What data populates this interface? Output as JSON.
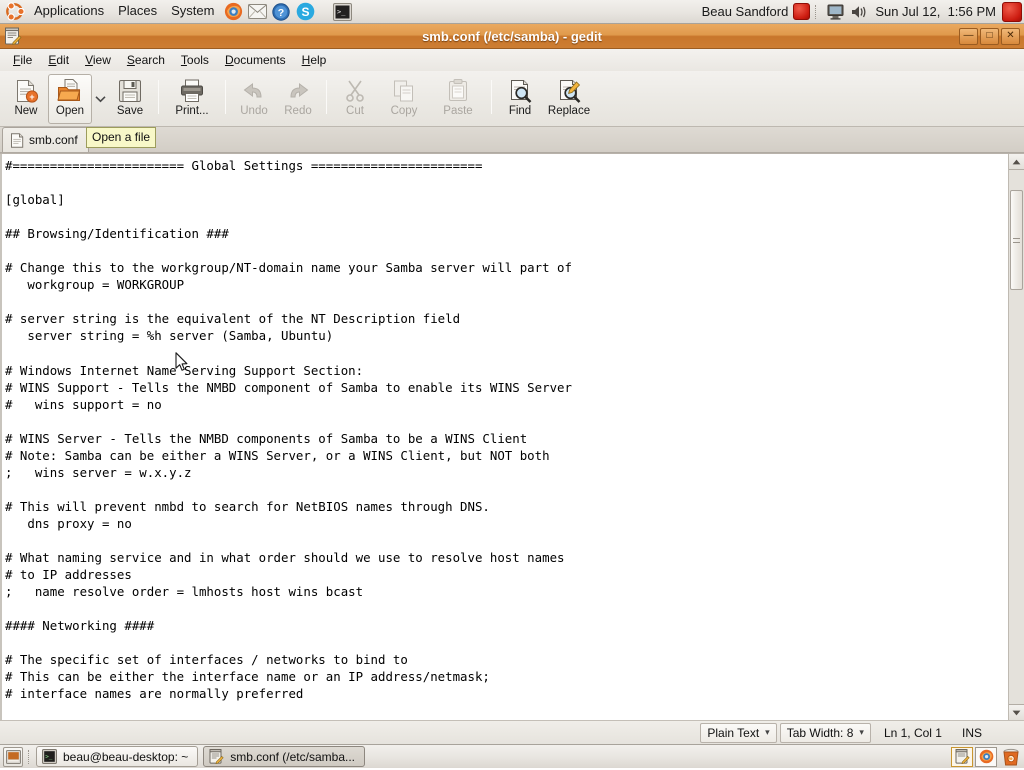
{
  "top_panel": {
    "logo": "ubuntu-logo",
    "menus": [
      "Applications",
      "Places",
      "System"
    ],
    "launchers": [
      "firefox-icon",
      "evolution-mail-icon",
      "help-icon",
      "skype-icon",
      "terminal-icon"
    ],
    "user_name": "Beau Sandford",
    "tray": [
      "display-icon",
      "volume-icon"
    ],
    "clock": "Sun Jul 12,  1:56 PM",
    "logout_label": "⏻",
    "shutdown_label": "⏻"
  },
  "window": {
    "title": "smb.conf (/etc/samba) - gedit",
    "icon": "gedit-icon",
    "buttons": {
      "minimize": "—",
      "maximize": "□",
      "close": "✕"
    }
  },
  "menubar": {
    "items": [
      {
        "label": "File",
        "accel": "F"
      },
      {
        "label": "Edit",
        "accel": "E"
      },
      {
        "label": "View",
        "accel": "V"
      },
      {
        "label": "Search",
        "accel": "S"
      },
      {
        "label": "Tools",
        "accel": "T"
      },
      {
        "label": "Documents",
        "accel": "D"
      },
      {
        "label": "Help",
        "accel": "H"
      }
    ]
  },
  "toolbar": {
    "new_label": "New",
    "open_label": "Open",
    "open_dropdown": "▼",
    "save_label": "Save",
    "print_label": "Print...",
    "undo_label": "Undo",
    "redo_label": "Redo",
    "cut_label": "Cut",
    "copy_label": "Copy",
    "paste_label": "Paste",
    "find_label": "Find",
    "replace_label": "Replace",
    "tooltip": "Open a file"
  },
  "tabs": [
    {
      "label": "smb.conf",
      "icon": "text-file-icon",
      "active": true
    }
  ],
  "editor": {
    "content": "#======================= Global Settings =======================\n\n[global]\n\n## Browsing/Identification ###\n\n# Change this to the workgroup/NT-domain name your Samba server will part of\n   workgroup = WORKGROUP\n\n# server string is the equivalent of the NT Description field\n   server string = %h server (Samba, Ubuntu)\n\n# Windows Internet Name Serving Support Section:\n# WINS Support - Tells the NMBD component of Samba to enable its WINS Server\n#   wins support = no\n\n# WINS Server - Tells the NMBD components of Samba to be a WINS Client\n# Note: Samba can be either a WINS Server, or a WINS Client, but NOT both\n;   wins server = w.x.y.z\n\n# This will prevent nmbd to search for NetBIOS names through DNS.\n   dns proxy = no\n\n# What naming service and in what order should we use to resolve host names\n# to IP addresses\n;   name resolve order = lmhosts host wins bcast\n\n#### Networking ####\n\n# The specific set of interfaces / networks to bind to\n# This can be either the interface name or an IP address/netmask;\n# interface names are normally preferred"
  },
  "scrollbar": {
    "up_arrow": "▲",
    "down_arrow": "▼"
  },
  "statusbar": {
    "language": "Plain Text",
    "language_caret": "▾",
    "tab_width": "Tab Width: 8",
    "tab_width_caret": "▾",
    "position": "Ln 1, Col 1",
    "insert_mode": "INS"
  },
  "taskbar": {
    "show_desktop": "show-desktop-icon",
    "tasks": [
      {
        "label": "beau@beau-desktop: ~",
        "icon": "terminal-icon",
        "active": false
      },
      {
        "label": "smb.conf (/etc/samba...",
        "icon": "gedit-icon",
        "active": true
      }
    ],
    "workspaces": [
      "gedit-icon",
      "firefox-icon"
    ],
    "trash": "trash-icon"
  },
  "colors": {
    "titlebar_orange": "#d8893c",
    "panel_grey": "#eae7e2",
    "tooltip_yellow": "#f8f8c8",
    "power_red": "#cc1b10",
    "editor_bg": "#ffffff"
  }
}
